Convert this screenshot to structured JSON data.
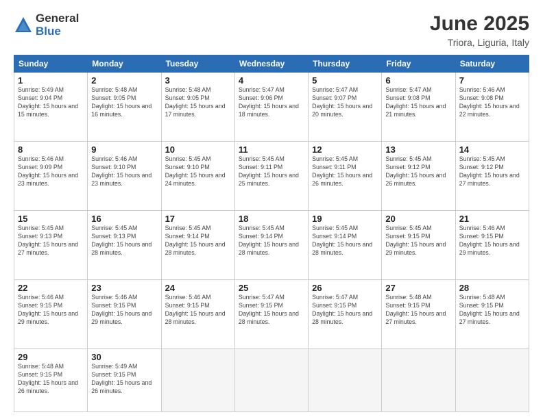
{
  "logo": {
    "general": "General",
    "blue": "Blue"
  },
  "title": "June 2025",
  "location": "Triora, Liguria, Italy",
  "days_of_week": [
    "Sunday",
    "Monday",
    "Tuesday",
    "Wednesday",
    "Thursday",
    "Friday",
    "Saturday"
  ],
  "weeks": [
    [
      {
        "day": "1",
        "sunrise": "5:49 AM",
        "sunset": "9:04 PM",
        "daylight": "15 hours and 15 minutes."
      },
      {
        "day": "2",
        "sunrise": "5:48 AM",
        "sunset": "9:05 PM",
        "daylight": "15 hours and 16 minutes."
      },
      {
        "day": "3",
        "sunrise": "5:48 AM",
        "sunset": "9:05 PM",
        "daylight": "15 hours and 17 minutes."
      },
      {
        "day": "4",
        "sunrise": "5:47 AM",
        "sunset": "9:06 PM",
        "daylight": "15 hours and 18 minutes."
      },
      {
        "day": "5",
        "sunrise": "5:47 AM",
        "sunset": "9:07 PM",
        "daylight": "15 hours and 20 minutes."
      },
      {
        "day": "6",
        "sunrise": "5:47 AM",
        "sunset": "9:08 PM",
        "daylight": "15 hours and 21 minutes."
      },
      {
        "day": "7",
        "sunrise": "5:46 AM",
        "sunset": "9:08 PM",
        "daylight": "15 hours and 22 minutes."
      }
    ],
    [
      {
        "day": "8",
        "sunrise": "5:46 AM",
        "sunset": "9:09 PM",
        "daylight": "15 hours and 23 minutes."
      },
      {
        "day": "9",
        "sunrise": "5:46 AM",
        "sunset": "9:10 PM",
        "daylight": "15 hours and 23 minutes."
      },
      {
        "day": "10",
        "sunrise": "5:45 AM",
        "sunset": "9:10 PM",
        "daylight": "15 hours and 24 minutes."
      },
      {
        "day": "11",
        "sunrise": "5:45 AM",
        "sunset": "9:11 PM",
        "daylight": "15 hours and 25 minutes."
      },
      {
        "day": "12",
        "sunrise": "5:45 AM",
        "sunset": "9:11 PM",
        "daylight": "15 hours and 26 minutes."
      },
      {
        "day": "13",
        "sunrise": "5:45 AM",
        "sunset": "9:12 PM",
        "daylight": "15 hours and 26 minutes."
      },
      {
        "day": "14",
        "sunrise": "5:45 AM",
        "sunset": "9:12 PM",
        "daylight": "15 hours and 27 minutes."
      }
    ],
    [
      {
        "day": "15",
        "sunrise": "5:45 AM",
        "sunset": "9:13 PM",
        "daylight": "15 hours and 27 minutes."
      },
      {
        "day": "16",
        "sunrise": "5:45 AM",
        "sunset": "9:13 PM",
        "daylight": "15 hours and 28 minutes."
      },
      {
        "day": "17",
        "sunrise": "5:45 AM",
        "sunset": "9:14 PM",
        "daylight": "15 hours and 28 minutes."
      },
      {
        "day": "18",
        "sunrise": "5:45 AM",
        "sunset": "9:14 PM",
        "daylight": "15 hours and 28 minutes."
      },
      {
        "day": "19",
        "sunrise": "5:45 AM",
        "sunset": "9:14 PM",
        "daylight": "15 hours and 28 minutes."
      },
      {
        "day": "20",
        "sunrise": "5:45 AM",
        "sunset": "9:15 PM",
        "daylight": "15 hours and 29 minutes."
      },
      {
        "day": "21",
        "sunrise": "5:46 AM",
        "sunset": "9:15 PM",
        "daylight": "15 hours and 29 minutes."
      }
    ],
    [
      {
        "day": "22",
        "sunrise": "5:46 AM",
        "sunset": "9:15 PM",
        "daylight": "15 hours and 29 minutes."
      },
      {
        "day": "23",
        "sunrise": "5:46 AM",
        "sunset": "9:15 PM",
        "daylight": "15 hours and 29 minutes."
      },
      {
        "day": "24",
        "sunrise": "5:46 AM",
        "sunset": "9:15 PM",
        "daylight": "15 hours and 28 minutes."
      },
      {
        "day": "25",
        "sunrise": "5:47 AM",
        "sunset": "9:15 PM",
        "daylight": "15 hours and 28 minutes."
      },
      {
        "day": "26",
        "sunrise": "5:47 AM",
        "sunset": "9:15 PM",
        "daylight": "15 hours and 28 minutes."
      },
      {
        "day": "27",
        "sunrise": "5:48 AM",
        "sunset": "9:15 PM",
        "daylight": "15 hours and 27 minutes."
      },
      {
        "day": "28",
        "sunrise": "5:48 AM",
        "sunset": "9:15 PM",
        "daylight": "15 hours and 27 minutes."
      }
    ],
    [
      {
        "day": "29",
        "sunrise": "5:48 AM",
        "sunset": "9:15 PM",
        "daylight": "15 hours and 26 minutes."
      },
      {
        "day": "30",
        "sunrise": "5:49 AM",
        "sunset": "9:15 PM",
        "daylight": "15 hours and 26 minutes."
      },
      null,
      null,
      null,
      null,
      null
    ]
  ]
}
